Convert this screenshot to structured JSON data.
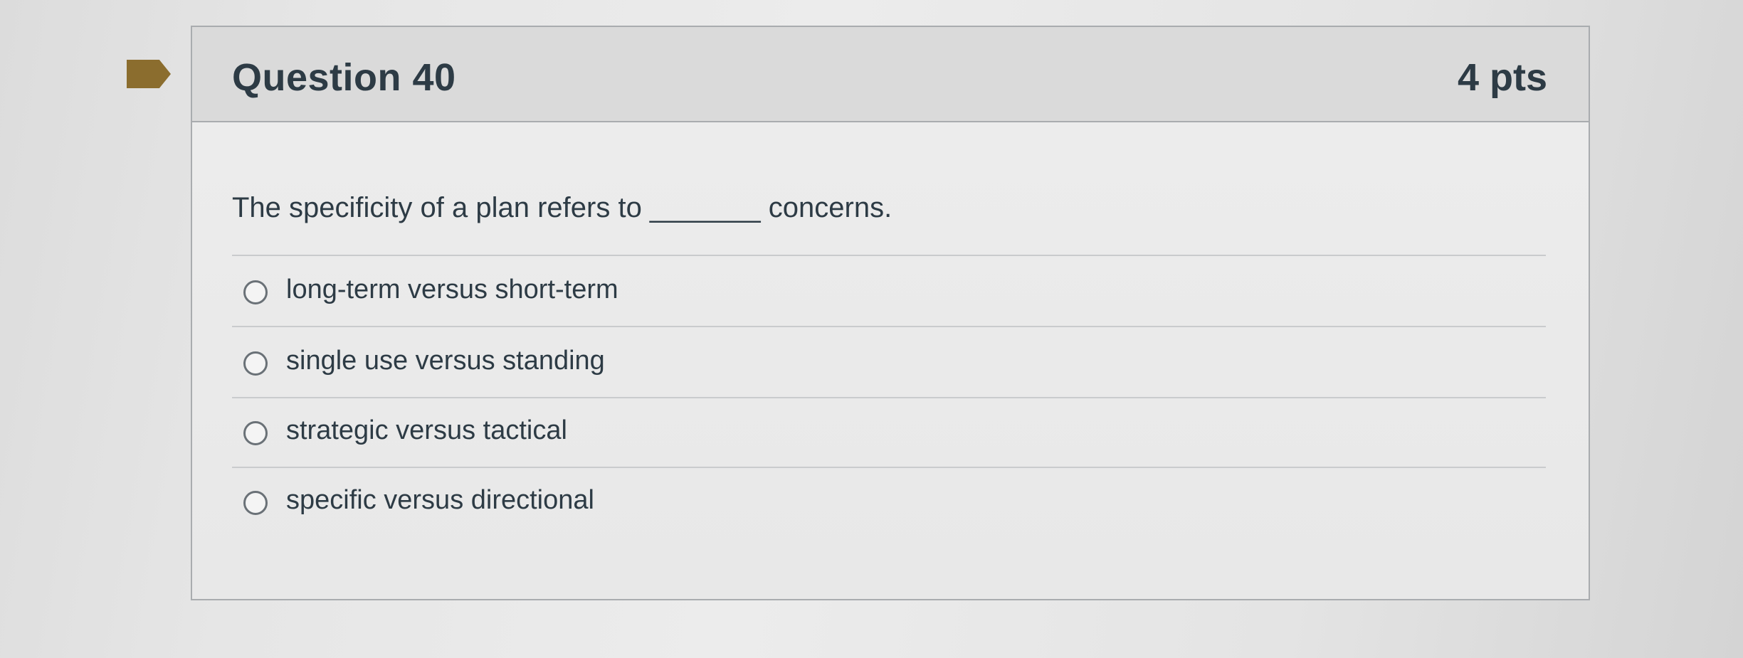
{
  "question": {
    "title": "Question 40",
    "points": "4 pts",
    "text": "The specificity of a plan refers to _______ concerns.",
    "answers": [
      {
        "label": "long-term versus short-term"
      },
      {
        "label": "single use versus standing"
      },
      {
        "label": "strategic versus tactical"
      },
      {
        "label": "specific versus directional"
      }
    ]
  },
  "colors": {
    "flag": "#8b6d2e",
    "header_bg": "#dadada",
    "body_bg": "#e9e9e9",
    "text": "#2d3b45",
    "border": "#a9acaf"
  },
  "icons": {
    "flag": "bookmark-flag-icon",
    "answer_control": "radio-button"
  }
}
